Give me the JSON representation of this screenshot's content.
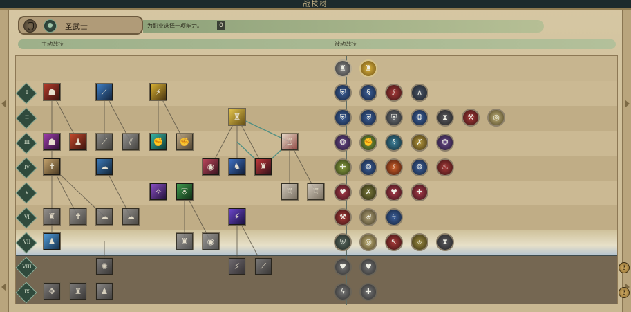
{
  "window": {
    "title": "战技树"
  },
  "class_panel": {
    "name": "圣武士",
    "icons": [
      "helmet-icon",
      "skull-icon"
    ]
  },
  "hint": {
    "text": "为职业选择一项能力。",
    "count": "0"
  },
  "columns": {
    "active": "主动战技",
    "passive": "被动战技"
  },
  "ranks": [
    "I",
    "II",
    "III",
    "IV",
    "V",
    "VI",
    "VII",
    "VIII",
    "IX"
  ],
  "colors": {
    "selected_row": "#e7e0c8",
    "locked_row": "#756752"
  }
}
